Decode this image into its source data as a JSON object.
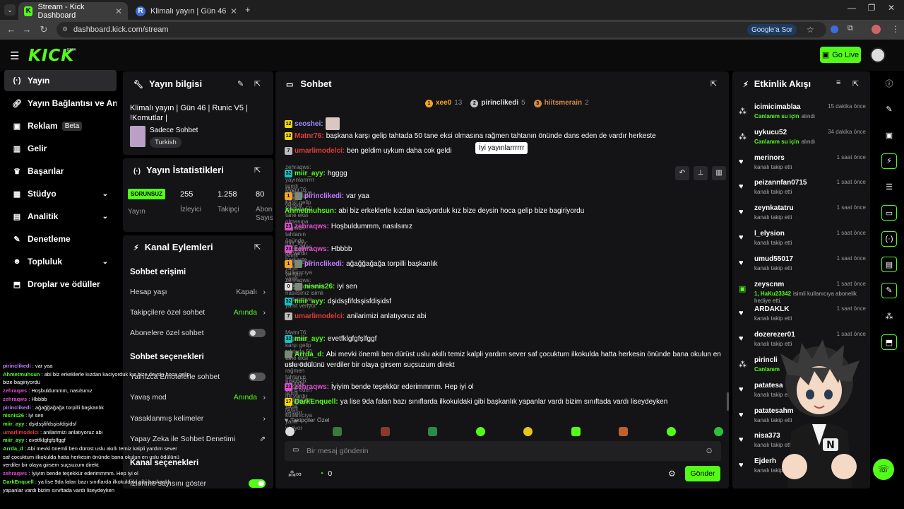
{
  "browser": {
    "tabs": [
      {
        "title": "Stream - Kick Dashboard",
        "fav": "K"
      },
      {
        "title": "Klimalı yayın | Gün 46 | Runic V5",
        "fav": "R"
      }
    ],
    "url": "dashboard.kick.com/stream",
    "google_button": "Google'a Sor"
  },
  "header": {
    "logo": "KICK",
    "beta": "BETA",
    "go_live": "Go Live"
  },
  "sidebar": {
    "items": [
      {
        "label": "Yayın",
        "icon": "broadcast-icon"
      },
      {
        "label": "Yayın Bağlantısı ve Anahtar",
        "icon": "link-icon"
      },
      {
        "label": "Reklam",
        "icon": "ad-icon",
        "badge": "Beta"
      },
      {
        "label": "Gelir",
        "icon": "chart-icon"
      },
      {
        "label": "Başarılar",
        "icon": "trophy-icon"
      },
      {
        "label": "Stüdyo",
        "icon": "studio-icon"
      },
      {
        "label": "Analitik",
        "icon": "analytics-icon"
      },
      {
        "label": "Denetleme",
        "icon": "wrench-icon"
      },
      {
        "label": "Topluluk",
        "icon": "community-icon"
      },
      {
        "label": "Droplar ve ödüller",
        "icon": "gift-icon"
      }
    ]
  },
  "info": {
    "title": "Yayın bilgisi",
    "stream_title": "Klimalı yayın | Gün 46 | Runic V5 | !Komutlar |",
    "category": "Sadece Sohbet",
    "language": "Turkish"
  },
  "stats": {
    "title": "Yayın İstatistikleri",
    "status": "SORUNSUZ",
    "status_label": "Yayın",
    "viewers": "255",
    "viewers_label": "İzleyici",
    "followers": "1.258",
    "followers_label": "Takipçi",
    "subs": "80",
    "subs_label": "Abone Sayısı"
  },
  "actions": {
    "title": "Kanal Eylemleri",
    "access_title": "Sohbet erişimi",
    "account_age": "Hesap yaşı",
    "account_age_val": "Kapalı",
    "followers_only": "Takipçilere özel sohbet",
    "followers_only_val": "Anında",
    "subs_only": "Abonelere özel sohbet",
    "options_title": "Sohbet seçenekleri",
    "emotes_only": "Yalnızca Emotelerle sohbet",
    "slow_mode": "Yavaş mod",
    "slow_mode_val": "Anında",
    "banned_words": "Yasaklanmış kelimeler",
    "ai_mod": "Yapay Zeka ile Sohbet Denetimi",
    "channel_settings": "Kanal seçenekleri",
    "show_viewers": "İzlenme sayısını göster"
  },
  "chat": {
    "title": "Sohbet",
    "top_gifters": [
      {
        "rank": "1",
        "name": "xee0",
        "count": "13",
        "color": "#f5a623"
      },
      {
        "rank": "2",
        "name": "pirinclikedi",
        "count": "5",
        "color": "#c0c0c0"
      },
      {
        "rank": "3",
        "name": "hiitsmerain",
        "count": "2",
        "color": "#d08a4a"
      }
    ],
    "tooltip": "İyi yayınlarrrrrr",
    "messages": [
      {
        "badge": "12",
        "bc": "#f5d90a",
        "user": "seoshei:",
        "uc": "#9b8cff",
        "text": ""
      },
      {
        "badge": "12",
        "bc": "#f5d90a",
        "user": "Matnr76:",
        "uc": "#e03b3b",
        "text": "başkana karşı gelip tahtada 50 tane eksi olmasına rağmen tahtanın önünde dans eden de vardır herkeste"
      },
      {
        "badge": "7",
        "bc": "#bbb",
        "user": "umarlimodelci:",
        "uc": "#e03b3b",
        "text": "ben geldim uykum daha cok geldi"
      },
      {
        "reply": "zehraqws: İyi yayınlarrrrrr isimli kullanıcıya yanıt veriyor"
      },
      {
        "badge": "32",
        "bc": "#18c3c3",
        "user": "miir_ayy:",
        "uc": "#53fc18",
        "text": "hgggg"
      },
      {
        "reply": "Matnr76: başkana karşı gelip tahtada 50 tane eksi olmasına rağmen tahtanın önünde dans eden de vardır herkeste isimli kullanıcıya yanıt veriyor"
      },
      {
        "badge": "1",
        "bc": "#f5a623",
        "user": "pirinclikedi:",
        "uc": "#c37bff",
        "text": "var yaa"
      },
      {
        "badge": "",
        "bc": "",
        "user": "Ahmetmuhsun:",
        "uc": "#53fc18",
        "text": "abi biz erkeklerle kızdan kaciyorduk kız bize deysin hoca gelip bize bagiriyordu"
      },
      {
        "badge": "23",
        "bc": "#e04fd0",
        "user": "zehraqws:",
        "uc": "#e04fd0",
        "text": "Hoşbuldummm, nasılsınız"
      },
      {
        "reply": "miir_ayy: hggggg isimli kullanıcıya yanıt veriyor"
      },
      {
        "badge": "23",
        "bc": "#e04fd0",
        "user": "zehraqws:",
        "uc": "#e04fd0",
        "text": "Hbbbb"
      },
      {
        "badge": "1",
        "bc": "#f5a623",
        "user": "pirinclikedi:",
        "uc": "#c37bff",
        "text": "ağağğağağa torpilli başkanlık"
      },
      {
        "reply": "zehraqws: Hoşbuldummm, nasılsınız isimli kullanıcıya yanıt veriyor"
      },
      {
        "badge": "0",
        "bc": "#ddd",
        "user": "nisnis26:",
        "uc": "#53fc18",
        "text": "iyi sen"
      },
      {
        "badge": "32",
        "bc": "#18c3c3",
        "user": "miir_ayy:",
        "uc": "#53fc18",
        "text": "dşidsşfifdsşisfdişidsf"
      },
      {
        "badge": "7",
        "bc": "#bbb",
        "user": "umarlimodelci:",
        "uc": "#e03b3b",
        "text": "anilarimizi anlatıyoruz abi"
      },
      {
        "reply": "Matnr76: başkana karşı gelip tahtada 50 tane eksi olmasına rağmen tahtanın önünde dans eden de vardır herkeste isimli kullanıcıya yanıt veriyor"
      },
      {
        "badge": "32",
        "bc": "#18c3c3",
        "user": "miir_ayy:",
        "uc": "#53fc18",
        "text": "evetfklgfgfşlfggf"
      },
      {
        "badge": "",
        "bc": "",
        "user": "Arrda_d:",
        "uc": "#53fc18",
        "text": "Abi mevki önemli ben dürüst uslu akıllı temiz kalpli yardım sever saf çocuktum ilkokulda hatta herkesin önünde bana okulun en"
      },
      {
        "cont": "uslu ödülünü verdiler bir olaya girsem suçsuzum direkt"
      },
      {
        "reply": "nisnis26: iyi sen isimli kullanıcıya yanıt veriyor"
      },
      {
        "badge": "23",
        "bc": "#e04fd0",
        "user": "zehraqws:",
        "uc": "#e04fd0",
        "text": "İyiyim bende teşekkür ederimmmm. Hep iyi ol"
      },
      {
        "badge": "17",
        "bc": "#f5d90a",
        "user": "DarkEnquell:",
        "uc": "#53fc18",
        "text": "ya lise 9da falan bazı sınıflarda ilkokuldaki gibi başkanlık yapanlar vardı bizim sınıftada vardı liseydeyken"
      }
    ],
    "followers_only_label": "Takipçiler Özel",
    "input_placeholder": "Bir mesaj gönderin",
    "points": "0",
    "send": "Gönder"
  },
  "feed": {
    "title": "Etkinlik Akışı",
    "items": [
      {
        "name": "icimicimablaa",
        "sub": "Canlanım su için",
        "sub2": "alındı",
        "time": "15 dakika önce",
        "icon": "drop-icon"
      },
      {
        "name": "uykucu52",
        "sub": "Canlanım su için",
        "sub2": "alındı",
        "time": "34 dakika önce",
        "icon": "drop-icon"
      },
      {
        "name": "merinors",
        "sub": "kanalı takip etti",
        "time": "1 saat önce",
        "icon": "heart-icon"
      },
      {
        "name": "peizannfan0715",
        "sub": "kanalı takip etti",
        "time": "1 saat önce",
        "icon": "heart-icon"
      },
      {
        "name": "zeynkatatru",
        "sub": "kanalı takip etti",
        "time": "1 saat önce",
        "icon": "heart-icon"
      },
      {
        "name": "l_elysion",
        "sub": "kanalı takip etti",
        "time": "1 saat önce",
        "icon": "heart-icon"
      },
      {
        "name": "umud55017",
        "sub": "kanalı takip etti",
        "time": "1 saat önce",
        "icon": "heart-icon"
      },
      {
        "name": "zeyscnm",
        "sub": "1, HaKu23342",
        "sub2": "isimli kullanıcıya abonelik hediye etti.",
        "time": "1 saat önce",
        "icon": "gift-icon"
      },
      {
        "name": "ARDAKLK",
        "sub": "kanalı takip etti",
        "time": "1 saat önce",
        "icon": "heart-icon"
      },
      {
        "name": "dozerezer01",
        "sub": "kanalı takip etti",
        "time": "1 saat önce",
        "icon": "heart-icon"
      },
      {
        "name": "pirincli",
        "sub": "Canlanım",
        "sub2": "",
        "time": "",
        "icon": "drop-icon"
      },
      {
        "name": "patatesa",
        "sub": "kanalı takip etti",
        "time": "",
        "icon": "heart-icon"
      },
      {
        "name": "patatesahm",
        "sub": "kanalı takip etti",
        "time": "",
        "icon": "heart-icon"
      },
      {
        "name": "nisa373",
        "sub": "kanalı takip etti",
        "time": "",
        "icon": "heart-icon"
      },
      {
        "name": "Ejderh",
        "sub": "kanalı takip etti",
        "time": "",
        "icon": "heart-icon"
      }
    ]
  },
  "overlay_chat": [
    {
      "u": "pirinclikedi",
      "uc": "#c37bff",
      "t": "var yaa"
    },
    {
      "u": "Ahmetmuhsun",
      "uc": "#53fc18",
      "t": "abi biz erkeklerle kızdan kaciyorduk kız bize deysin hoca gelip"
    },
    {
      "u": "",
      "uc": "",
      "t": "bize bagiriyordu"
    },
    {
      "u": "zehraqws",
      "uc": "#e04fd0",
      "t": "Hoşbuldummm, nasılsınız"
    },
    {
      "u": "zehraqws",
      "uc": "#e04fd0",
      "t": "Hbbbb"
    },
    {
      "u": "pirinclikedi",
      "uc": "#c37bff",
      "t": "ağağğağağa torpilli başkanlık"
    },
    {
      "u": "nisnis26",
      "uc": "#53fc18",
      "t": "iyi sen"
    },
    {
      "u": "miir_ayy",
      "uc": "#53fc18",
      "t": "dşidsşfifdsşisfdişidsf"
    },
    {
      "u": "umarlimodelci",
      "uc": "#e03b3b",
      "t": "anilarimizi anlatıyoruz abi"
    },
    {
      "u": "miir_ayy",
      "uc": "#53fc18",
      "t": "evetfklgfgfşlfggf"
    },
    {
      "u": "Arrda_d",
      "uc": "#53fc18",
      "t": "Abi mevki önemli ben dürüst uslu akıllı temiz kalpli yardım sever"
    },
    {
      "u": "",
      "uc": "",
      "t": "saf çocuktum ilkokulda hatta herkesin önünde bana okulun en uslu ödülünü"
    },
    {
      "u": "",
      "uc": "",
      "t": "verdiler bir olaya girsem suçsuzum direkt"
    },
    {
      "u": "zehraqws",
      "uc": "#e04fd0",
      "t": "İyiyim bende teşekkür ederimmmm. Hep iyi ol"
    },
    {
      "u": "DarkEnquell",
      "uc": "#53fc18",
      "t": "ya lise 9da falan bazı sınıflarda ilkokuldaki gibi başkanlık"
    },
    {
      "u": "",
      "uc": "",
      "t": "yapanlar vardı bizim sınıftada vardı liseydeyken"
    }
  ],
  "colors": {
    "accent": "#53fc18",
    "panel": "#141416",
    "bg": "#000000"
  }
}
